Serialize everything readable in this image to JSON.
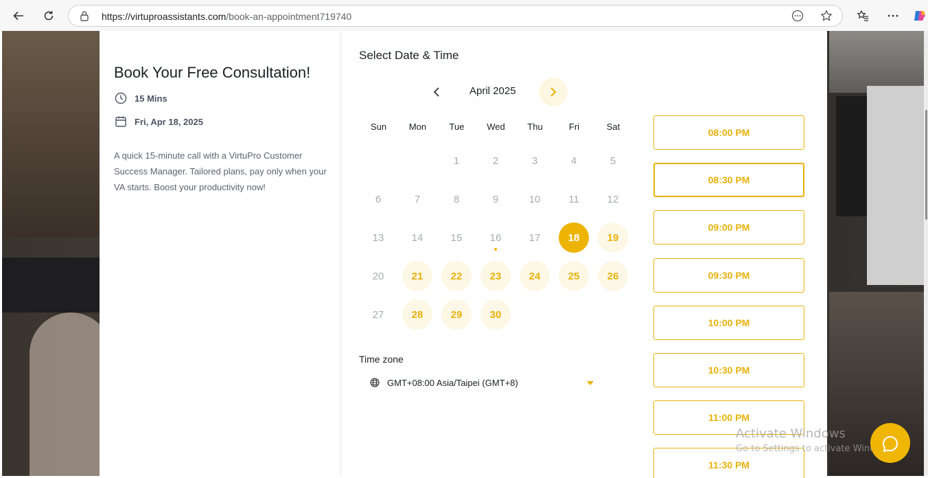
{
  "browser": {
    "url_host": "https://virtuproassistants.com",
    "url_path": "/book-an-appointment719740"
  },
  "booking": {
    "title": "Book Your Free Consultation!",
    "duration": "15 Mins",
    "date": "Fri, Apr 18, 2025",
    "description": "A quick 15-minute call with a VirtuPro Customer Success Manager. Tailored plans, pay only when your VA starts. Boost your productivity now!"
  },
  "calendar": {
    "heading": "Select Date & Time",
    "month": "April 2025",
    "weekdays": [
      "Sun",
      "Mon",
      "Tue",
      "Wed",
      "Thu",
      "Fri",
      "Sat"
    ],
    "weeks": [
      [
        "",
        "",
        "1",
        "2",
        "3",
        "4",
        "5"
      ],
      [
        "6",
        "7",
        "8",
        "9",
        "10",
        "11",
        "12"
      ],
      [
        "13",
        "14",
        "15",
        "16",
        "17",
        "18",
        "19"
      ],
      [
        "20",
        "21",
        "22",
        "23",
        "24",
        "25",
        "26"
      ],
      [
        "27",
        "28",
        "29",
        "30",
        "",
        "",
        ""
      ]
    ],
    "available_days": [
      "19",
      "21",
      "22",
      "23",
      "24",
      "25",
      "26",
      "28",
      "29",
      "30"
    ],
    "selected_day": "18",
    "today_day": "16"
  },
  "timezone": {
    "label": "Time zone",
    "value": "GMT+08:00 Asia/Taipei (GMT+8)"
  },
  "time_slots": [
    "08:00 PM",
    "08:30 PM",
    "09:00 PM",
    "09:30 PM",
    "10:00 PM",
    "10:30 PM",
    "11:00 PM",
    "11:30 PM"
  ],
  "active_slot": "08:30 PM",
  "watermark": {
    "line1": "Activate Windows",
    "line2": "Go to Settings to activate Windows."
  },
  "colors": {
    "accent": "#eeb404",
    "accent_soft": "#fdf7e6",
    "muted_day": "#a8abb0"
  }
}
